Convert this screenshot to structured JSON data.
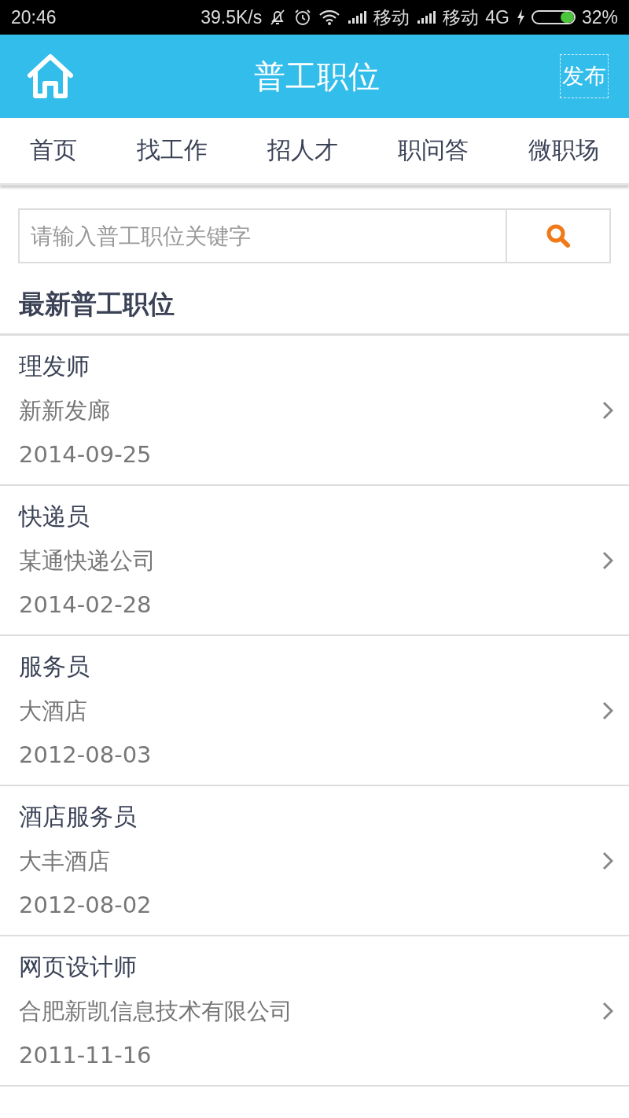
{
  "status_bar": {
    "time": "20:46",
    "speed": "39.5K/s",
    "carrier_1": "移动",
    "carrier_2": "移动",
    "network": "4G",
    "battery": "32%"
  },
  "header": {
    "title": "普工职位",
    "publish": "发布"
  },
  "nav": [
    "首页",
    "找工作",
    "招人才",
    "职问答",
    "微职场"
  ],
  "search": {
    "placeholder": "请输入普工职位关键字"
  },
  "section_title": "最新普工职位",
  "jobs": [
    {
      "title": "理发师",
      "company": "新新发廊",
      "date": "2014-09-25"
    },
    {
      "title": "快递员",
      "company": "某通快递公司",
      "date": "2014-02-28"
    },
    {
      "title": "服务员",
      "company": "大酒店",
      "date": "2012-08-03"
    },
    {
      "title": "酒店服务员",
      "company": "大丰酒店",
      "date": "2012-08-02"
    },
    {
      "title": "网页设计师",
      "company": "合肥新凯信息技术有限公司",
      "date": "2011-11-16"
    }
  ]
}
